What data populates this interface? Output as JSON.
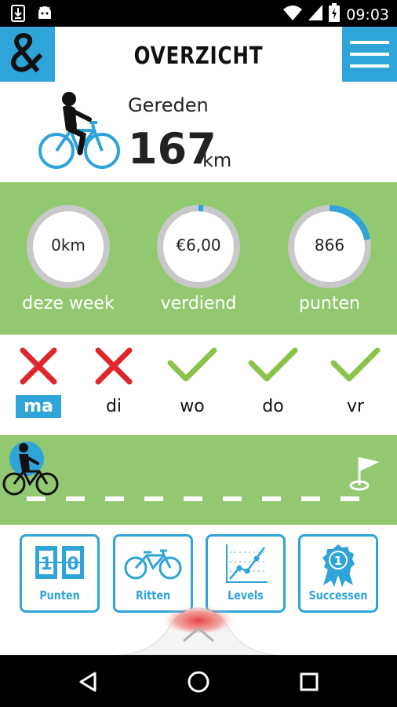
{
  "status_bar": {
    "time": "09:03",
    "icons": [
      "download-icon",
      "android-icon",
      "wifi-icon",
      "signal-icon",
      "battery-charging-icon"
    ]
  },
  "header": {
    "title": "OVERZICHT",
    "logo_icon": "ampersand-logo-icon",
    "menu_icon": "hamburger-menu-icon"
  },
  "summary": {
    "label": "Gereden",
    "distance": "167",
    "unit": "km",
    "icon": "cyclist-icon"
  },
  "stats": [
    {
      "value": "0km",
      "label": "deze week",
      "progress": 0
    },
    {
      "value": "€6,00",
      "label": "verdiend",
      "progress": 0.02
    },
    {
      "value": "866",
      "label": "punten",
      "progress": 0.22
    }
  ],
  "days": [
    {
      "label": "ma",
      "status": "missed",
      "active": true
    },
    {
      "label": "di",
      "status": "missed",
      "active": false
    },
    {
      "label": "wo",
      "status": "done",
      "active": false
    },
    {
      "label": "do",
      "status": "done",
      "active": false
    },
    {
      "label": "vr",
      "status": "done",
      "active": false
    }
  ],
  "track": {
    "rider_icon": "cyclist-marker-icon",
    "finish_icon": "finish-flag-icon",
    "progress": 0
  },
  "tiles": [
    {
      "label": "Punten",
      "icon": "scoreboard-icon",
      "digits": [
        "1",
        "0"
      ]
    },
    {
      "label": "Ritten",
      "icon": "bicycle-icon"
    },
    {
      "label": "Levels",
      "icon": "line-graph-icon"
    },
    {
      "label": "Successen",
      "icon": "award-ribbon-icon",
      "badge": "1"
    }
  ],
  "colors": {
    "accent_blue": "#2fa4d8",
    "green_band": "#92c870",
    "check_green": "#8bc34a",
    "cross_red": "#e0262d",
    "ring_gray": "#c8c8c8"
  },
  "nav_bar": [
    "back-icon",
    "home-icon",
    "recents-icon"
  ]
}
